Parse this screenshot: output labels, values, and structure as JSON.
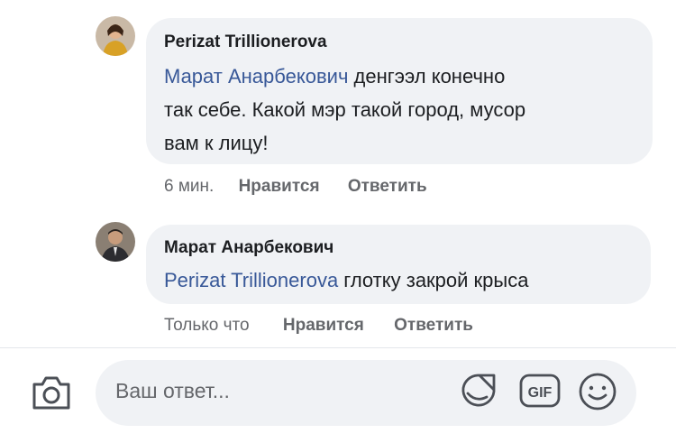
{
  "comments": [
    {
      "author": "Perizat Trillionerova",
      "mention": "Марат Анарбекович",
      "text_line1": " денгээл конечно",
      "text_line2": "так себе. Какой мэр такой город, мусор",
      "text_line3": "вам к лицу!",
      "time": "6 мин.",
      "like_label": "Нравится",
      "reply_label": "Ответить"
    },
    {
      "author": "Марат Анарбекович",
      "mention": "Perizat Trillionerova",
      "text": " глотку закрой крыса",
      "time": "Только что",
      "like_label": "Нравится",
      "reply_label": "Ответить"
    }
  ],
  "composer": {
    "placeholder": "Ваш ответ...",
    "icons": [
      "camera-icon",
      "sticker-icon",
      "gif-icon",
      "emoji-icon"
    ],
    "gif_label": "GIF"
  },
  "colors": {
    "mention": "#385898",
    "bubble": "#f0f2f5",
    "secondary_text": "#65676b"
  }
}
